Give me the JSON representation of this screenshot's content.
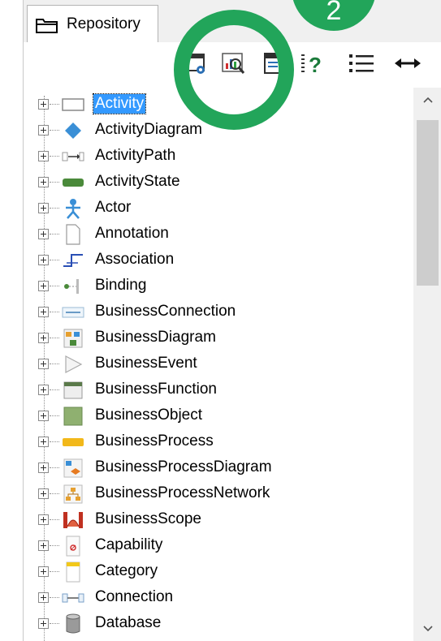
{
  "tab": {
    "label": "Repository",
    "icon": "folder-icon"
  },
  "toolbar": {
    "buttons": [
      {
        "name": "properties-window-button",
        "icon": "window-gear-icon"
      },
      {
        "name": "search-repository-button",
        "icon": "magnifier-chart-icon"
      },
      {
        "name": "panel-view-button",
        "icon": "panel-icon"
      },
      {
        "name": "show-help-button",
        "icon": "list-question-icon"
      },
      {
        "name": "list-view-button",
        "icon": "list-icon"
      },
      {
        "name": "expand-width-button",
        "icon": "double-arrow-icon"
      }
    ]
  },
  "badge": {
    "number": "2",
    "color": "#22a55a"
  },
  "tree": {
    "selected_color": "#3399ff",
    "items": [
      {
        "label": "Activity",
        "icon": "activity-icon",
        "selected": true
      },
      {
        "label": "ActivityDiagram",
        "icon": "activity-diagram-icon"
      },
      {
        "label": "ActivityPath",
        "icon": "activity-path-icon"
      },
      {
        "label": "ActivityState",
        "icon": "activity-state-icon"
      },
      {
        "label": "Actor",
        "icon": "actor-icon"
      },
      {
        "label": "Annotation",
        "icon": "annotation-icon"
      },
      {
        "label": "Association",
        "icon": "association-icon"
      },
      {
        "label": "Binding",
        "icon": "binding-icon"
      },
      {
        "label": "BusinessConnection",
        "icon": "business-connection-icon"
      },
      {
        "label": "BusinessDiagram",
        "icon": "business-diagram-icon"
      },
      {
        "label": "BusinessEvent",
        "icon": "business-event-icon"
      },
      {
        "label": "BusinessFunction",
        "icon": "business-function-icon"
      },
      {
        "label": "BusinessObject",
        "icon": "business-object-icon"
      },
      {
        "label": "BusinessProcess",
        "icon": "business-process-icon"
      },
      {
        "label": "BusinessProcessDiagram",
        "icon": "business-process-diagram-icon"
      },
      {
        "label": "BusinessProcessNetwork",
        "icon": "business-process-network-icon"
      },
      {
        "label": "BusinessScope",
        "icon": "business-scope-icon"
      },
      {
        "label": "Capability",
        "icon": "capability-icon"
      },
      {
        "label": "Category",
        "icon": "category-icon"
      },
      {
        "label": "Connection",
        "icon": "connection-icon"
      },
      {
        "label": "Database",
        "icon": "database-icon"
      }
    ]
  }
}
